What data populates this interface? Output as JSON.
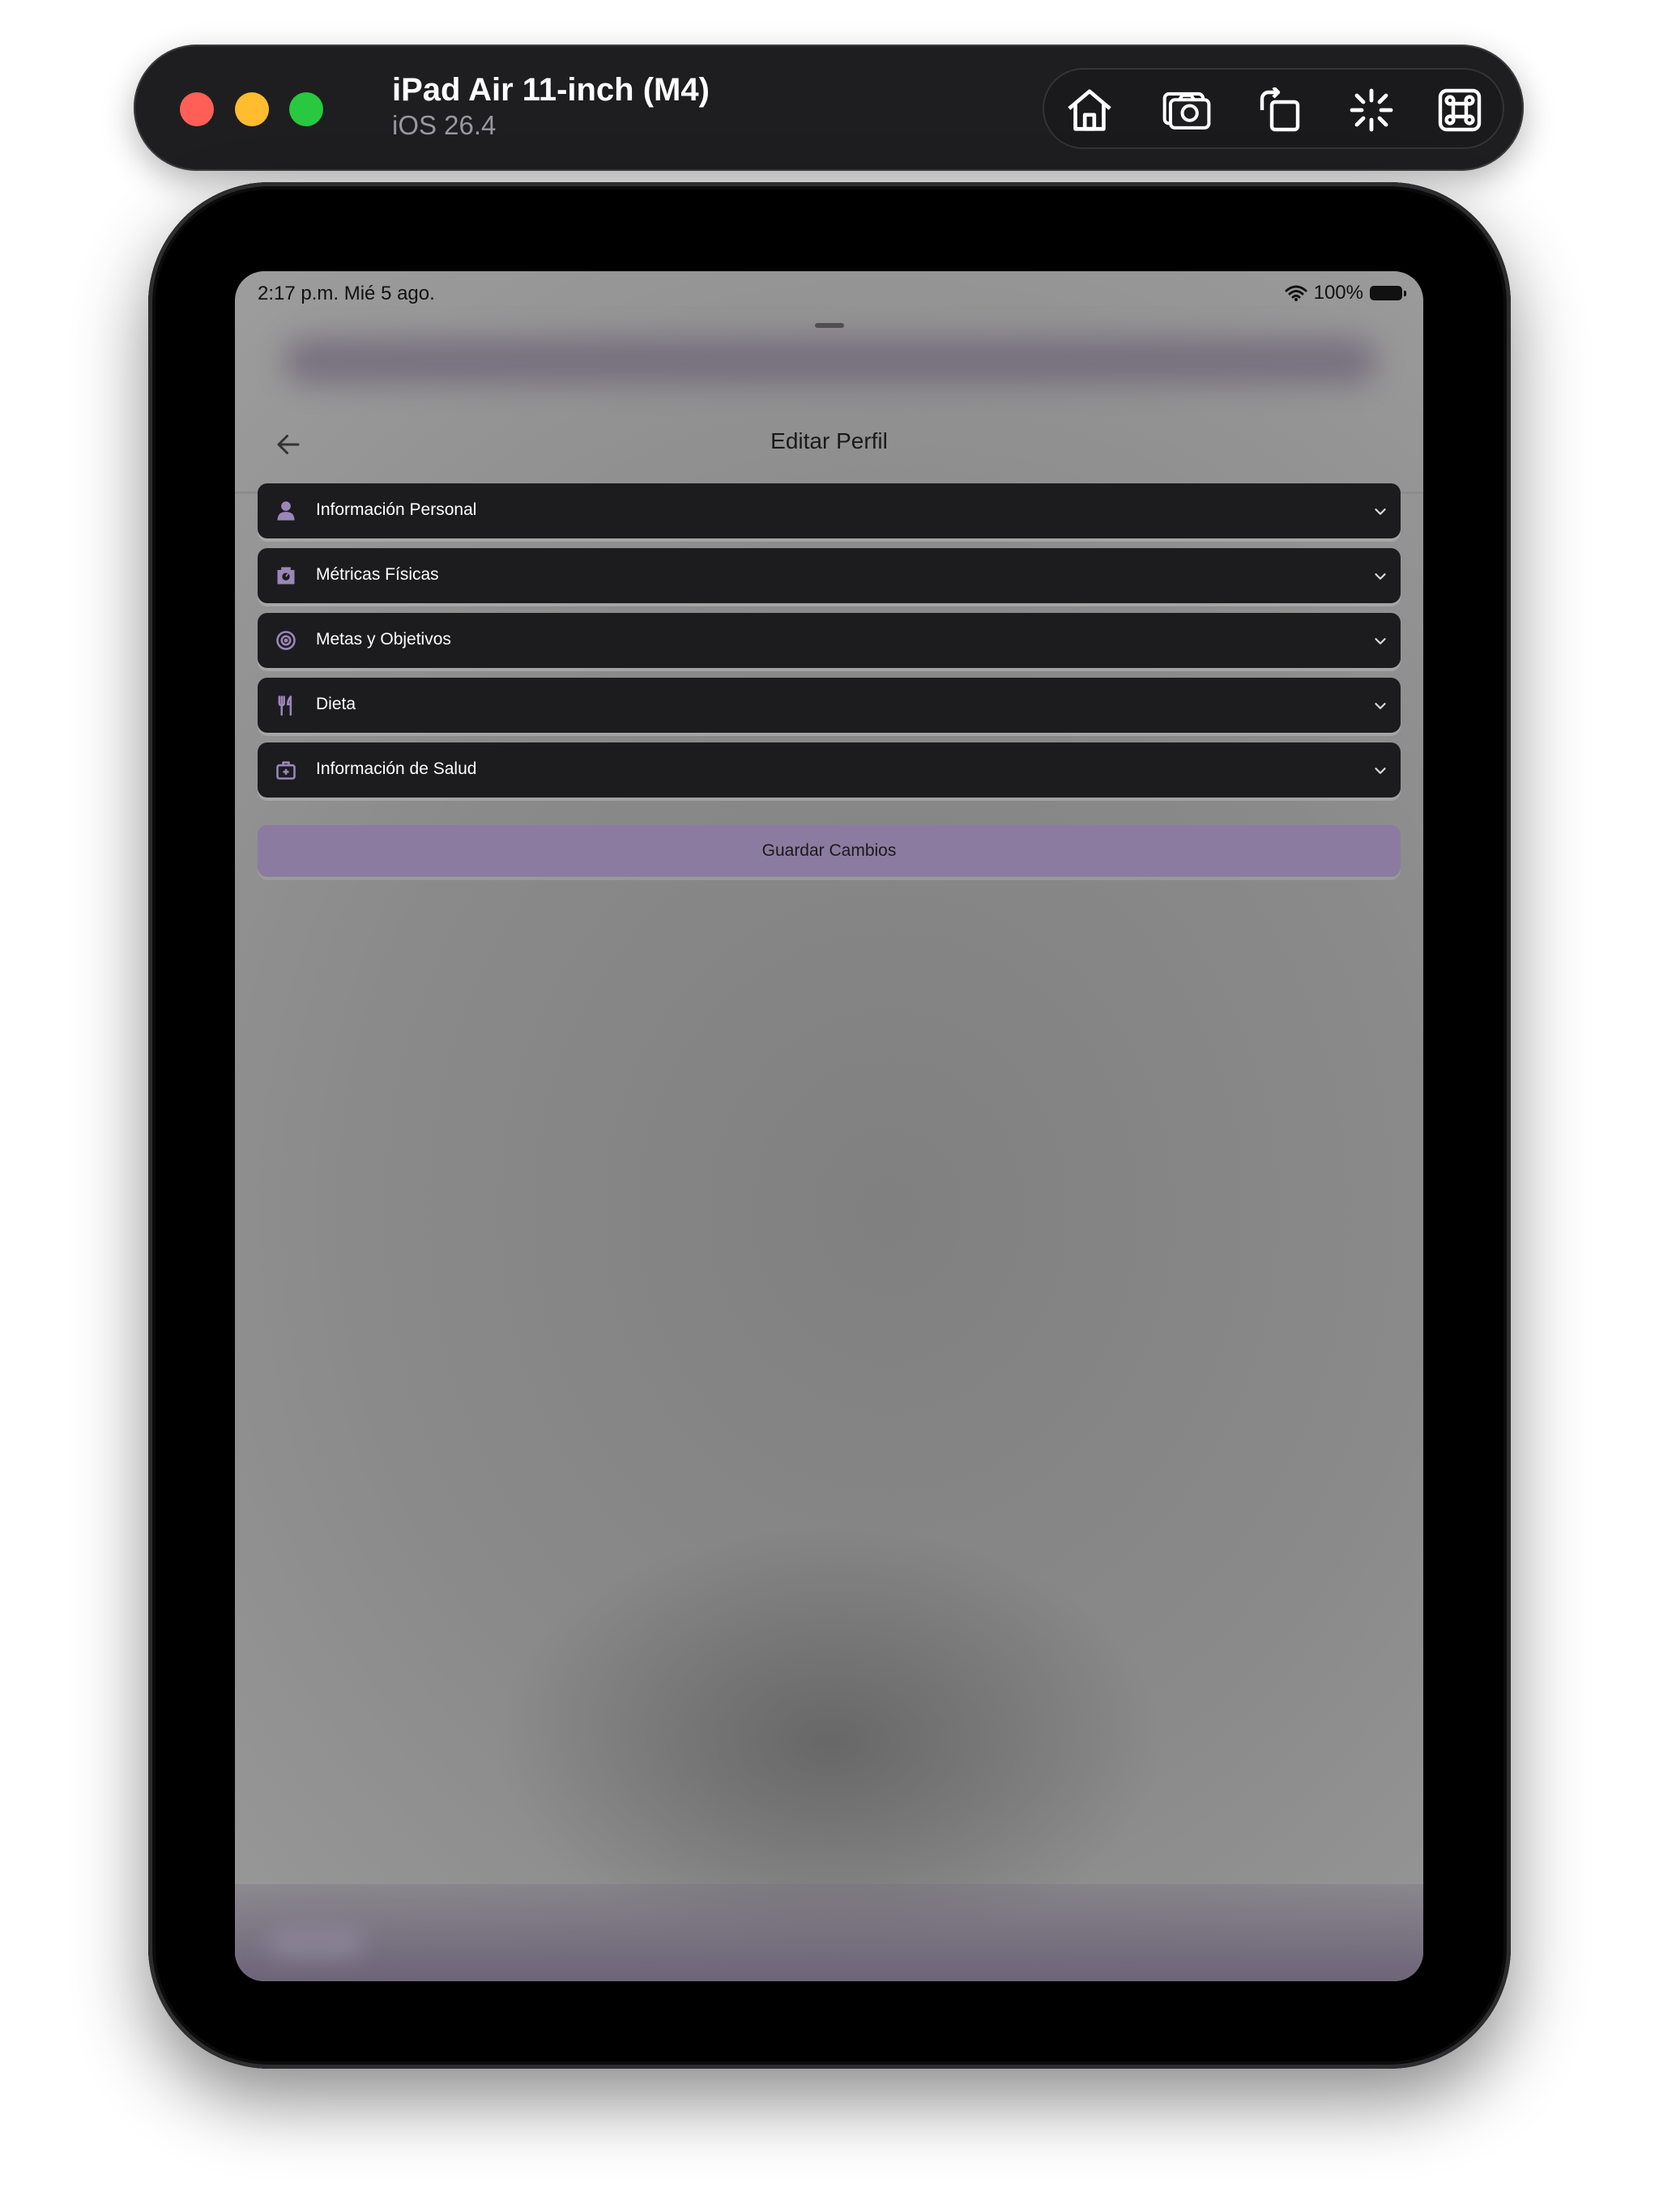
{
  "simulator": {
    "device_name": "iPad Air 11-inch (M4)",
    "os_version": "iOS 26.4",
    "toolbar_icons": [
      "home-icon",
      "screenshot-icon",
      "rotate-icon",
      "shake-icon",
      "command-icon"
    ]
  },
  "status_bar": {
    "time_date": "2:17 p.m.   Mié 5 ago.",
    "battery": "100%"
  },
  "nav": {
    "title": "Editar Perfil",
    "back_icon": "arrow-left-icon"
  },
  "sections": [
    {
      "label": "Información Personal",
      "icon": "person-icon"
    },
    {
      "label": "Métricas Físicas",
      "icon": "scale-icon"
    },
    {
      "label": "Metas y Objetivos",
      "icon": "target-icon"
    },
    {
      "label": "Dieta",
      "icon": "fork-knife-icon"
    },
    {
      "label": "Información de Salud",
      "icon": "medical-kit-icon"
    }
  ],
  "save_button": {
    "label": "Guardar Cambios"
  },
  "colors": {
    "accent": "#8c7ba0",
    "row_background": "#1c1c1e",
    "icon_accent": "#9b86b8",
    "danger": "#e05555"
  }
}
